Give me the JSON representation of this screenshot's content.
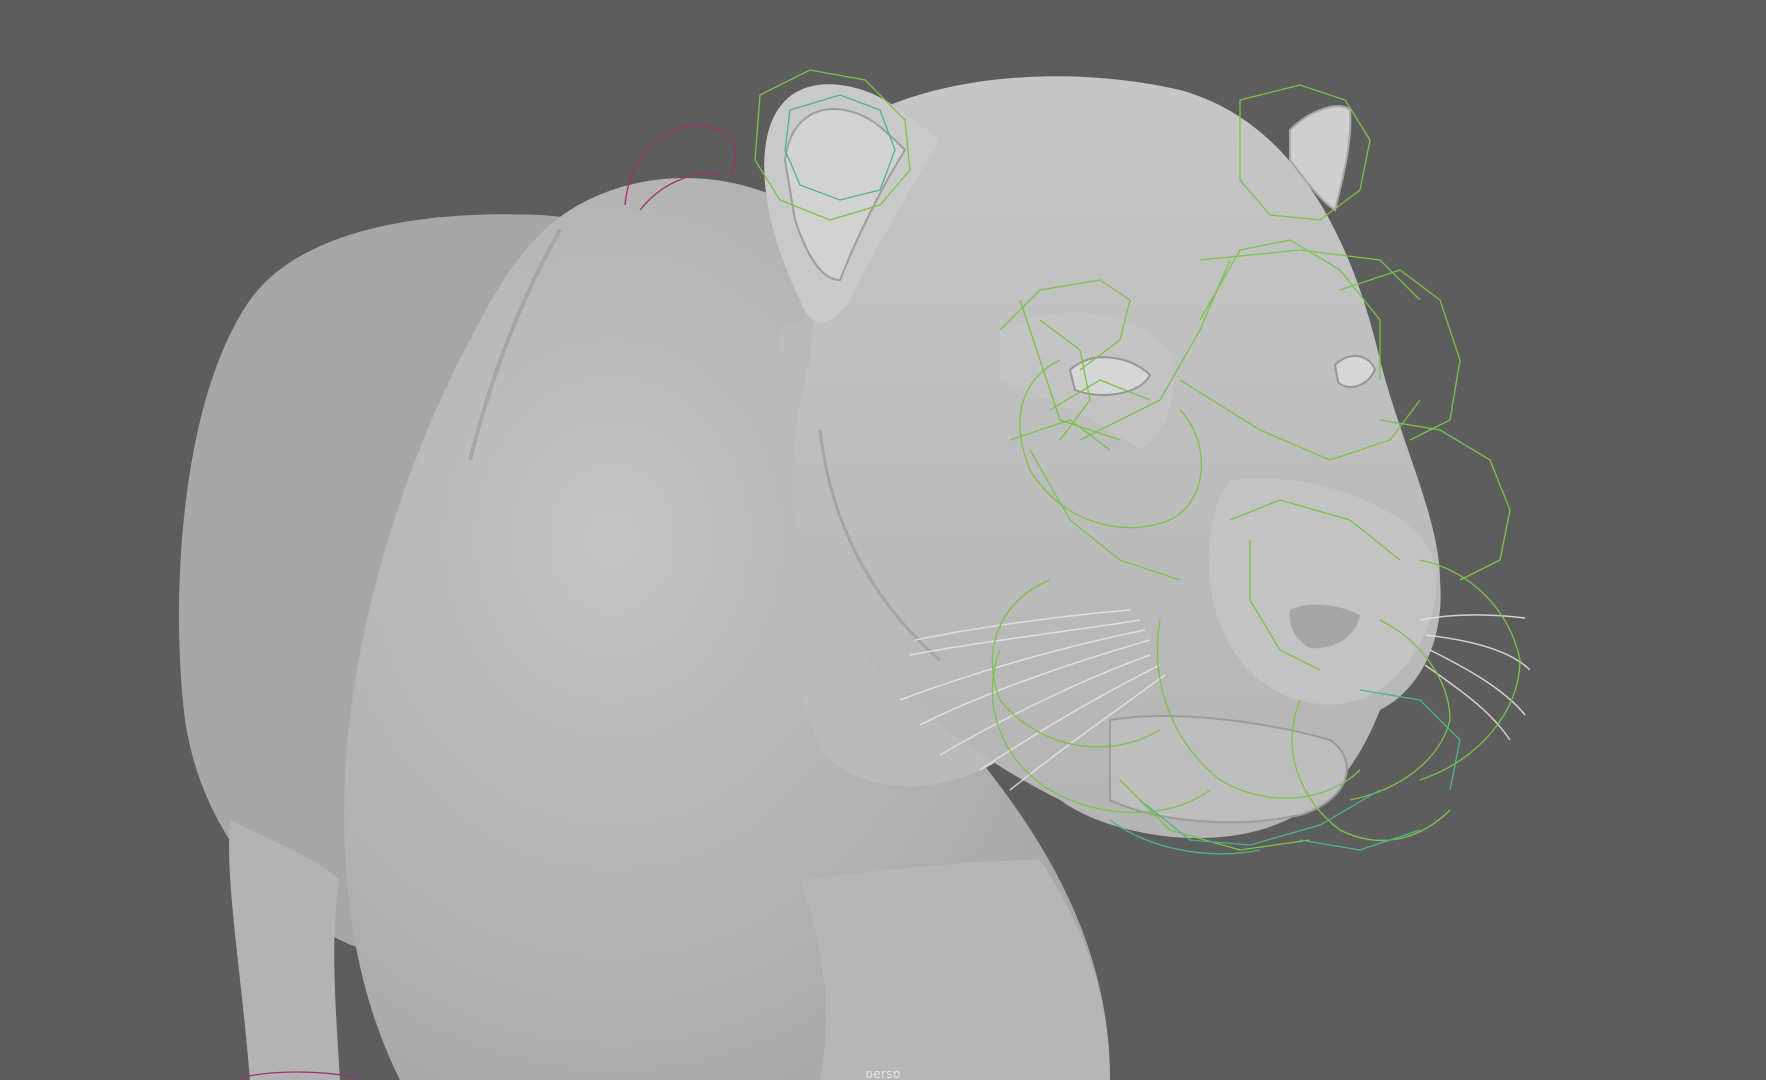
{
  "viewport": {
    "camera_label": "persp",
    "background_color": "#5d5d5d",
    "model_color": "#b9b9b9",
    "controls_primary_color": "#7cc24a",
    "controls_secondary_color": "#4fb38a",
    "control_accent_color": "#a3306e",
    "whisker_color": "#e8e8e8"
  }
}
